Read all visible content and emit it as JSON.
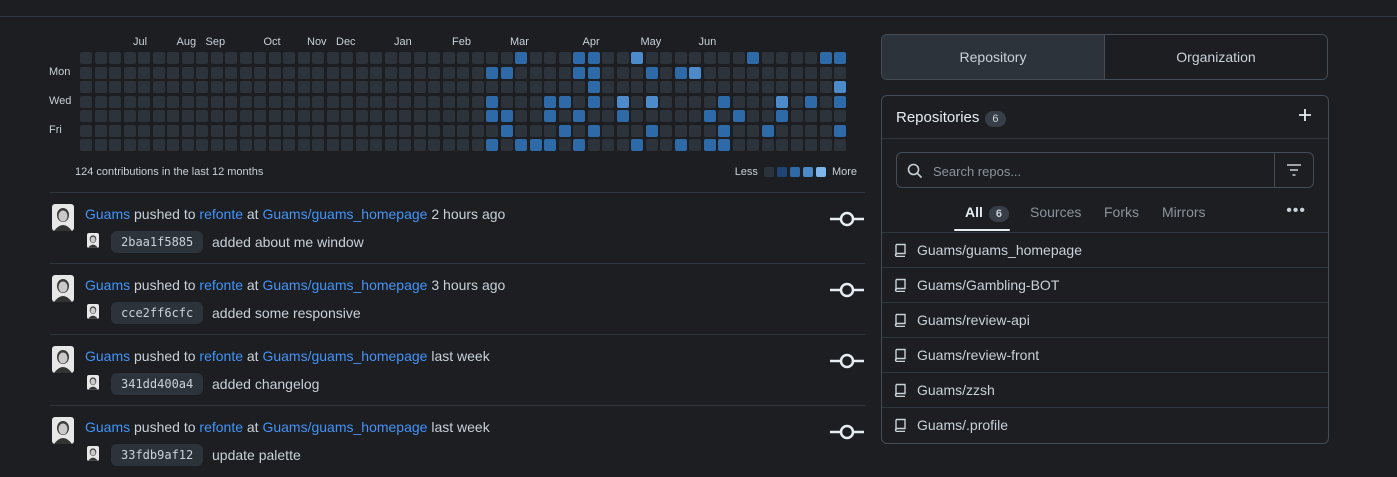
{
  "graph": {
    "months": [
      {
        "label": "Jul",
        "col": 2
      },
      {
        "label": "Aug",
        "col": 5
      },
      {
        "label": "Sep",
        "col": 7
      },
      {
        "label": "Oct",
        "col": 11
      },
      {
        "label": "Nov",
        "col": 14
      },
      {
        "label": "Dec",
        "col": 16
      },
      {
        "label": "Jan",
        "col": 20
      },
      {
        "label": "Feb",
        "col": 24
      },
      {
        "label": "Mar",
        "col": 28
      },
      {
        "label": "Apr",
        "col": 33
      },
      {
        "label": "May",
        "col": 37
      },
      {
        "label": "Jun",
        "col": 41
      }
    ],
    "day_labels": [
      {
        "label": "Mon",
        "row": 1
      },
      {
        "label": "Wed",
        "row": 3
      },
      {
        "label": "Fri",
        "row": 5
      }
    ],
    "weeks": 53,
    "active": [
      [
        29,
        1,
        2
      ],
      [
        30,
        0,
        2
      ],
      [
        34,
        0,
        2
      ],
      [
        35,
        0,
        2
      ],
      [
        38,
        0,
        3
      ],
      [
        46,
        0,
        2
      ],
      [
        51,
        0,
        2
      ],
      [
        52,
        0,
        2
      ],
      [
        28,
        1,
        2
      ],
      [
        34,
        1,
        2
      ],
      [
        35,
        1,
        2
      ],
      [
        39,
        1,
        2
      ],
      [
        41,
        1,
        2
      ],
      [
        42,
        1,
        3
      ],
      [
        35,
        2,
        2
      ],
      [
        52,
        2,
        3
      ],
      [
        28,
        3,
        2
      ],
      [
        32,
        3,
        2
      ],
      [
        33,
        3,
        2
      ],
      [
        35,
        3,
        2
      ],
      [
        37,
        3,
        3
      ],
      [
        39,
        3,
        3
      ],
      [
        44,
        3,
        2
      ],
      [
        48,
        3,
        3
      ],
      [
        50,
        3,
        2
      ],
      [
        52,
        3,
        2
      ],
      [
        28,
        4,
        2
      ],
      [
        29,
        4,
        2
      ],
      [
        32,
        4,
        2
      ],
      [
        34,
        4,
        2
      ],
      [
        37,
        4,
        2
      ],
      [
        43,
        4,
        2
      ],
      [
        45,
        4,
        2
      ],
      [
        48,
        4,
        2
      ],
      [
        29,
        5,
        2
      ],
      [
        33,
        5,
        2
      ],
      [
        35,
        5,
        2
      ],
      [
        39,
        5,
        2
      ],
      [
        44,
        5,
        2
      ],
      [
        47,
        5,
        2
      ],
      [
        52,
        5,
        2
      ],
      [
        28,
        6,
        2
      ],
      [
        30,
        6,
        2
      ],
      [
        31,
        6,
        2
      ],
      [
        32,
        6,
        2
      ],
      [
        34,
        6,
        2
      ],
      [
        38,
        6,
        2
      ],
      [
        41,
        6,
        2
      ],
      [
        43,
        6,
        2
      ],
      [
        44,
        6,
        2
      ]
    ],
    "levels": [
      "#2d333b",
      "#1e4573",
      "#2f6aa8",
      "#4d8ac9",
      "#7fb5e8"
    ],
    "summary": "124 contributions in the last 12 months",
    "legend_less": "Less",
    "legend_more": "More"
  },
  "feed": [
    {
      "user": "Guams",
      "pushed_to": "pushed to",
      "branch": "refonte",
      "at": "at",
      "repo": "Guams/guams_homepage",
      "time": "2 hours ago",
      "sha": "2baa1f5885",
      "message": "added about me window"
    },
    {
      "user": "Guams",
      "pushed_to": "pushed to",
      "branch": "refonte",
      "at": "at",
      "repo": "Guams/guams_homepage",
      "time": "3 hours ago",
      "sha": "cce2ff6cfc",
      "message": "added some responsive"
    },
    {
      "user": "Guams",
      "pushed_to": "pushed to",
      "branch": "refonte",
      "at": "at",
      "repo": "Guams/guams_homepage",
      "time": "last week",
      "sha": "341dd400a4",
      "message": "added changelog"
    },
    {
      "user": "Guams",
      "pushed_to": "pushed to",
      "branch": "refonte",
      "at": "at",
      "repo": "Guams/guams_homepage",
      "time": "last week",
      "sha": "33fdb9af12",
      "message": "update palette"
    }
  ],
  "switcher": {
    "repository": "Repository",
    "organization": "Organization"
  },
  "repos_panel": {
    "title": "Repositories",
    "count": "6",
    "search_placeholder": "Search repos...",
    "tabs": {
      "all": "All",
      "all_count": "6",
      "sources": "Sources",
      "forks": "Forks",
      "mirrors": "Mirrors"
    },
    "more": "•••",
    "items": [
      "Guams/guams_homepage",
      "Guams/Gambling-BOT",
      "Guams/review-api",
      "Guams/review-front",
      "Guams/zzsh",
      "Guams/.profile"
    ]
  }
}
